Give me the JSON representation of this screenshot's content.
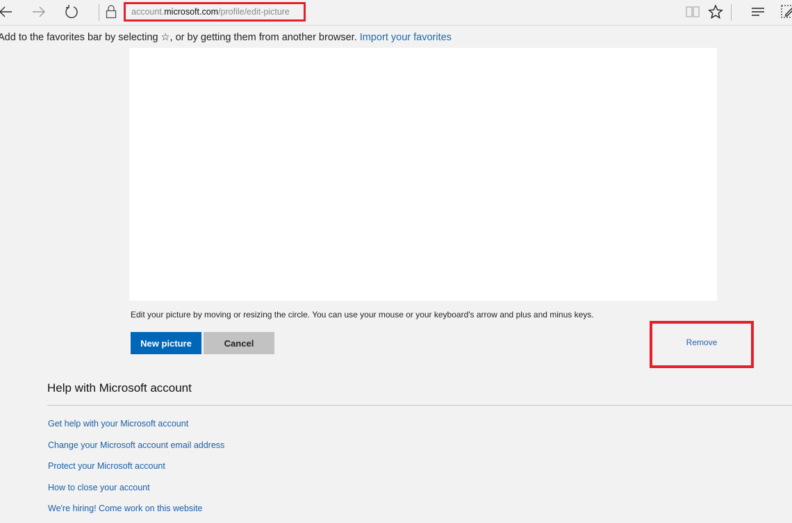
{
  "browser": {
    "address": {
      "prefix": "account.",
      "host": "microsoft.com",
      "path": "/profile/edit-picture"
    },
    "icons": {
      "back": "back-arrow-icon",
      "forward": "forward-arrow-icon",
      "refresh": "refresh-icon",
      "lock": "lock-icon",
      "reading_view": "reading-view-icon",
      "favorite": "star-icon",
      "hub": "hub-icon",
      "web_note": "web-note-icon"
    },
    "favorites_bar": {
      "message": "Add to the favorites bar by selecting ☆, or by getting them from another browser.",
      "link": "Import your favorites"
    }
  },
  "editor": {
    "hint": "Edit your picture by moving or resizing the circle. You can use your mouse or your keyboard's arrow and plus and minus keys.",
    "new_picture_label": "New picture",
    "cancel_label": "Cancel",
    "remove_label": "Remove"
  },
  "help": {
    "title": "Help with Microsoft account",
    "links": [
      "Get help with your Microsoft account",
      "Change your Microsoft account email address",
      "Protect your Microsoft account",
      "How to close your account",
      "We're hiring! Come work on this website"
    ]
  },
  "colors": {
    "accent": "#0067b8",
    "link": "#1a6bb0",
    "highlight": "#e3202b"
  }
}
